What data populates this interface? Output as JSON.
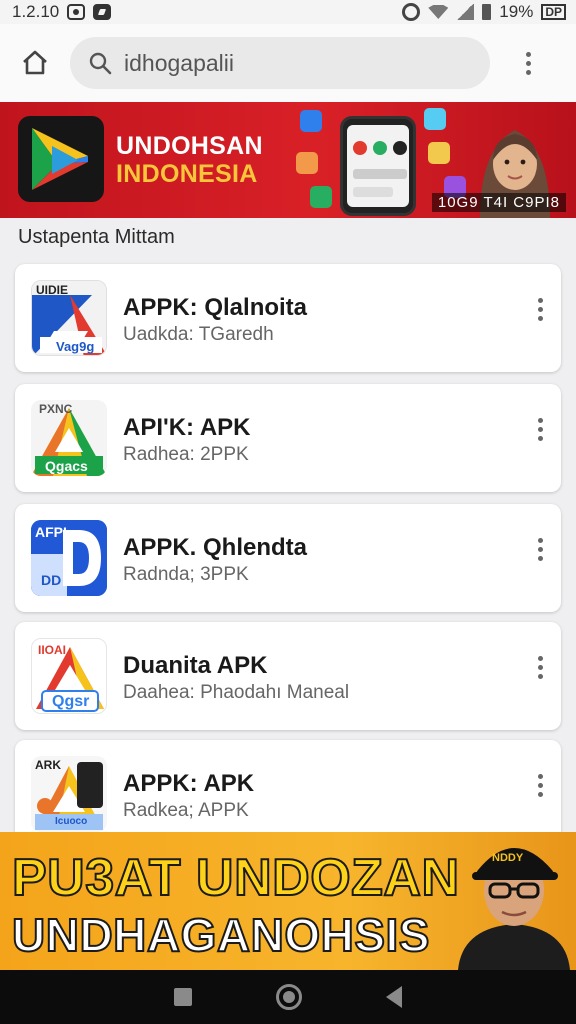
{
  "status_bar": {
    "time": "1.2.10",
    "battery": "19%",
    "right_label": "DP"
  },
  "browser": {
    "url_text": "idhogapalii"
  },
  "banner": {
    "title_line1": "UNDOHSAN",
    "title_line2": "INDONESIA",
    "tag": "10G9 T4I C9PI8"
  },
  "list": {
    "heading": "Ustapenta Mittam",
    "items": [
      {
        "name": "APPK: Qlalnoita",
        "subtitle": "Uadkda: TGaredh",
        "icon_label": "UIDIE",
        "icon_sub": "Vag9g"
      },
      {
        "name": "API'K: APK",
        "subtitle": "Radhea: 2PPK",
        "icon_label": "PXNC",
        "icon_sub": "Qgacs"
      },
      {
        "name": "APPK. Qhlendta",
        "subtitle": "Radnda; 3PPK",
        "icon_label": "AFPI",
        "icon_sub": "DD"
      },
      {
        "name": "Duanita APK",
        "subtitle": "Daahea: Phaodahı Maneal",
        "icon_label": "IIOAI",
        "icon_sub": "Qgsr"
      },
      {
        "name": "APPK: APK",
        "subtitle": "Radkea; APPK",
        "icon_label": "ARK",
        "icon_sub": "Icuoco"
      }
    ]
  },
  "promo": {
    "line1": "PU3AT UNDOZAN",
    "line2": "UNDHAGANOHSIS",
    "cap_text": "NDDY"
  },
  "colors": {
    "banner_red": "#d92027",
    "banner_gold": "#f8c63a",
    "promo_orange": "#f7b52c"
  }
}
